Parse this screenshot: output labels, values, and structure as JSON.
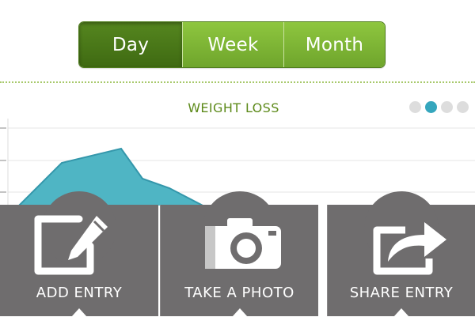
{
  "range_selector": {
    "options": [
      "Day",
      "Week",
      "Month"
    ],
    "selected": "Day"
  },
  "chart": {
    "title": "WEIGHT LOSS",
    "pager": {
      "pages": 4,
      "current": 2
    },
    "fill_color": "#4fb5c4",
    "line_color": "#3497ab"
  },
  "actions": [
    {
      "label": "ADD ENTRY",
      "icon": "edit-icon"
    },
    {
      "label": "TAKE A PHOTO",
      "icon": "camera-icon"
    },
    {
      "label": "SHARE ENTRY",
      "icon": "share-icon"
    }
  ],
  "colors": {
    "accent_green": "#7cb633",
    "active_green": "#4c7d1a",
    "bar_gray": "#6f6d6e"
  }
}
